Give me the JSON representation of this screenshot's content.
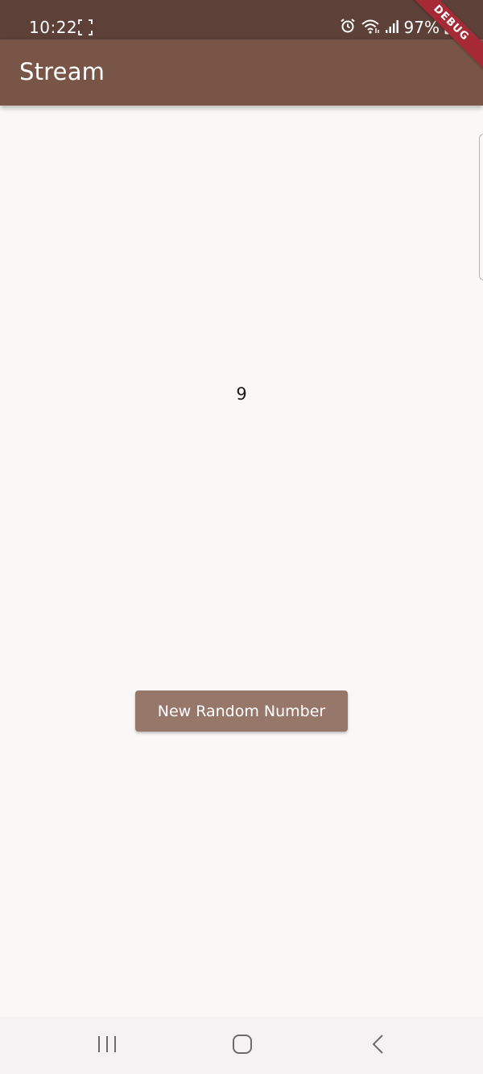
{
  "status_bar": {
    "time": "10:22",
    "battery": "97%",
    "icons": [
      "screenshot-icon",
      "alarm-icon",
      "wifi-icon",
      "signal-icon",
      "battery-charging-icon"
    ]
  },
  "debug_banner": {
    "label": "DEBUG"
  },
  "app_bar": {
    "title": "Stream"
  },
  "main": {
    "number": "9",
    "button_label": "New Random Number"
  },
  "nav_bar": {
    "icons": [
      "recents-icon",
      "home-icon",
      "back-icon"
    ]
  },
  "colors": {
    "status_bar": "#5d4038",
    "app_bar": "#795548",
    "button": "#98776b",
    "background": "#faf8f7",
    "nav_bar": "#f4f2f3",
    "debug_ribbon": "#a62a36"
  }
}
